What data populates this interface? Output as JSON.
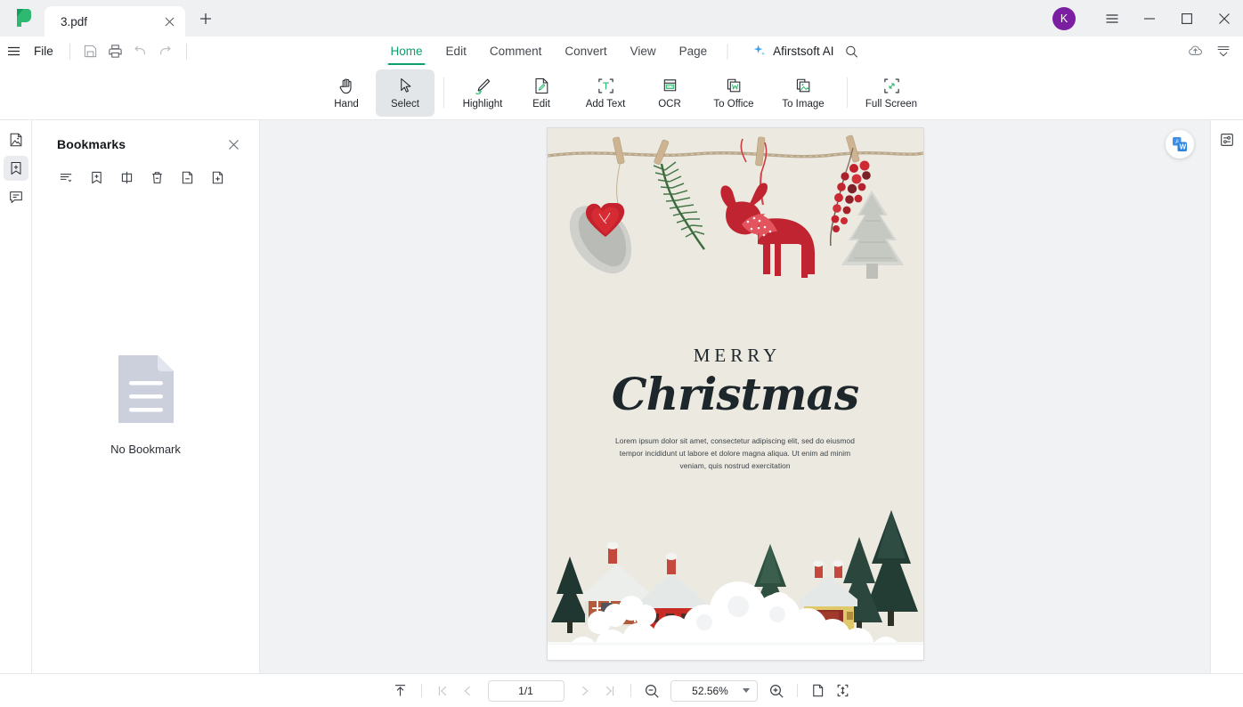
{
  "window": {
    "app_logo": "afirstsoft-logo",
    "tabs": [
      {
        "label": "3.pdf",
        "close_icon": "close-icon"
      }
    ],
    "new_tab_icon": "plus-icon",
    "avatar_initial": "K",
    "avatar_color": "#7b1fa2",
    "controls": {
      "menu": "hamburger-icon",
      "minimize": "minimize-icon",
      "maximize": "maximize-icon",
      "close": "close-icon"
    }
  },
  "menubar": {
    "hamburger_icon": "hamburger-icon",
    "file_label": "File",
    "quick_actions": [
      {
        "name": "save-icon"
      },
      {
        "name": "print-icon"
      },
      {
        "name": "undo-icon"
      },
      {
        "name": "redo-icon"
      }
    ],
    "ribbon_tabs": [
      {
        "label": "Home",
        "active": true
      },
      {
        "label": "Edit",
        "active": false
      },
      {
        "label": "Comment",
        "active": false
      },
      {
        "label": "Convert",
        "active": false
      },
      {
        "label": "View",
        "active": false
      },
      {
        "label": "Page",
        "active": false
      }
    ],
    "ai_label": "Afirstsoft AI",
    "ai_icon": "sparkle-icon",
    "search_icon": "search-icon",
    "cloud_icon": "cloud-upload-icon",
    "collapse_icon": "collapse-ribbon-icon",
    "accent_color": "#0e9f6e"
  },
  "toolbar": {
    "items": [
      {
        "label": "Hand",
        "icon": "hand-icon",
        "selected": false
      },
      {
        "label": "Select",
        "icon": "cursor-arrow-icon",
        "selected": true
      },
      {
        "label": "Highlight",
        "icon": "highlighter-icon",
        "selected": false
      },
      {
        "label": "Edit",
        "icon": "edit-document-icon",
        "selected": false
      },
      {
        "label": "Add Text",
        "icon": "add-text-icon",
        "selected": false
      },
      {
        "label": "OCR",
        "icon": "ocr-icon",
        "selected": false
      },
      {
        "label": "To Office",
        "icon": "to-office-icon",
        "selected": false
      },
      {
        "label": "To Image",
        "icon": "to-image-icon",
        "selected": false
      },
      {
        "label": "Full Screen",
        "icon": "full-screen-icon",
        "selected": false
      }
    ]
  },
  "left_rail": {
    "items": [
      {
        "name": "thumbnails-icon",
        "active": false
      },
      {
        "name": "bookmark-icon",
        "active": true
      },
      {
        "name": "comment-icon",
        "active": false
      }
    ]
  },
  "bookmarks_panel": {
    "title": "Bookmarks",
    "close_icon": "close-icon",
    "tools": [
      {
        "name": "expand-list-icon"
      },
      {
        "name": "add-bookmark-icon"
      },
      {
        "name": "rename-bookmark-icon"
      },
      {
        "name": "delete-bookmark-icon"
      },
      {
        "name": "remove-page-icon"
      },
      {
        "name": "add-page-icon"
      }
    ],
    "empty_icon": "empty-document-icon",
    "empty_label": "No Bookmark"
  },
  "document": {
    "float_button_icon": "pdf-to-word-icon",
    "page_background": "#ece9e0",
    "card": {
      "heading_small": "MERRY",
      "heading_script": "Christmas",
      "body": "Lorem ipsum dolor sit amet, consectetur adipiscing elit, sed do eiusmod tempor incididunt ut labore et dolore magna aliqua. Ut enim ad minim veniam, quis nostrud exercitation"
    }
  },
  "right_rail": {
    "items": [
      {
        "name": "properties-panel-icon"
      }
    ]
  },
  "statusbar": {
    "scroll_top_icon": "scroll-to-top-icon",
    "first_page_icon": "first-page-icon",
    "prev_page_icon": "previous-page-icon",
    "page_value": "1/1",
    "next_page_icon": "next-page-icon",
    "last_page_icon": "last-page-icon",
    "zoom_out_icon": "zoom-out-icon",
    "zoom_value": "52.56%",
    "zoom_in_icon": "zoom-in-icon",
    "fit_page_icon": "fit-page-icon",
    "fit_width_icon": "fit-height-icon"
  }
}
